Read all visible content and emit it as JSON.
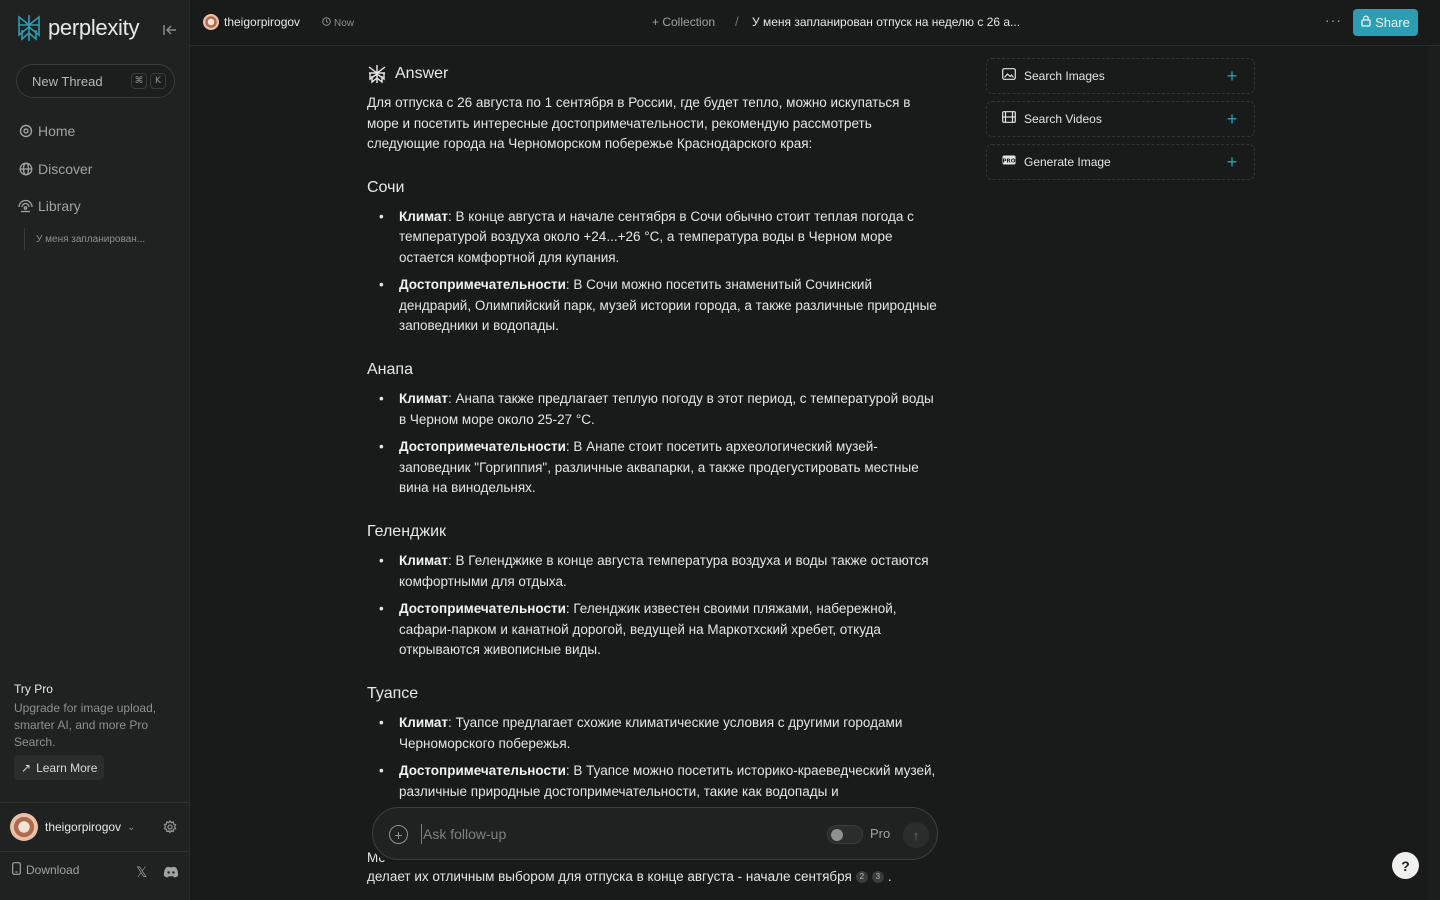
{
  "sidebar": {
    "logo_text": "perplexity",
    "new_thread": {
      "label": "New Thread",
      "shortcut_keys": [
        "⌘",
        "K"
      ]
    },
    "nav": [
      {
        "label": "Home",
        "icon": "search-icon"
      },
      {
        "label": "Discover",
        "icon": "globe-icon"
      },
      {
        "label": "Library",
        "icon": "library-icon"
      }
    ],
    "library_items": [
      "У меня запланирован..."
    ],
    "try_pro": {
      "title": "Try Pro",
      "description": "Upgrade for image upload, smarter AI, and more Pro Search.",
      "button": "Learn More"
    },
    "user": {
      "name": "theigorpirogov"
    },
    "download_label": "Download"
  },
  "header": {
    "user": "theigorpirogov",
    "time": "Now",
    "collection": "+ Collection",
    "separator": "/",
    "thread_title": "У меня запланирован отпуск на неделю с 26 а...",
    "more": "···",
    "share": "Share"
  },
  "answer": {
    "heading": "Answer",
    "intro": "Для отпуска с 26 августа по 1 сентября в России, где будет тепло, можно искупаться в море и посетить интересные достопримечательности, рекомендую рассмотреть следующие города на Черноморском побережье Краснодарского края:",
    "sections": [
      {
        "title": "Сочи",
        "items": [
          {
            "label": "Климат",
            "text": ": В конце августа и начале сентября в Сочи обычно стоит теплая погода с температурой воздуха около +24...+26 °C, а температура воды в Черном море остается комфортной для купания."
          },
          {
            "label": "Достопримечательности",
            "text": ": В Сочи можно посетить знаменитый Сочинский дендрарий, Олимпийский парк, музей истории города, а также различные природные заповедники и водопады."
          }
        ]
      },
      {
        "title": "Анапа",
        "items": [
          {
            "label": "Климат",
            "text": ": Анапа также предлагает теплую погоду в этот период, с температурой воды в Черном море около 25-27 °C."
          },
          {
            "label": "Достопримечательности",
            "text": ": В Анапе стоит посетить археологический музей-заповедник \"Горгиппия\", различные аквапарки, а также продегустировать местные вина на винодельнях."
          }
        ]
      },
      {
        "title": "Геленджик",
        "items": [
          {
            "label": "Климат",
            "text": ": В Геленджике в конце августа температура воздуха и воды также остаются комфортными для отдыха."
          },
          {
            "label": "Достопримечательности",
            "text": ": Геленджик известен своими пляжами, набережной, сафари-парком и канатной дорогой, ведущей на Маркотхский хребет, откуда открываются живописные виды."
          }
        ]
      },
      {
        "title": "Туапсе",
        "items": [
          {
            "label": "Климат",
            "text": ": Туапсе предлагает схожие климатические условия с другими городами Черноморского побережья."
          },
          {
            "label": "Достопримечательности",
            "text": ": В Туапсе можно посетить историко-краеведческий музей, различные природные достопримечательности, такие как водопады и"
          }
        ]
      }
    ],
    "tail_partial": "Мо",
    "tail": "делает их отличным выбором для отпуска в конце августа - начале сентября",
    "citations": [
      "2",
      "3"
    ],
    "tail_end": "."
  },
  "followup": {
    "placeholder": "Ask follow-up",
    "value": "",
    "pro_label": "Pro",
    "pro_enabled": false
  },
  "right_panel": [
    {
      "label": "Search Images",
      "icon": "image-icon"
    },
    {
      "label": "Search Videos",
      "icon": "film-icon"
    },
    {
      "label": "Generate Image",
      "icon": "pro-icon"
    }
  ],
  "help": "?",
  "colors": {
    "accent": "#2b9eb3",
    "background": "#191a1a",
    "sidebar": "#202222"
  }
}
